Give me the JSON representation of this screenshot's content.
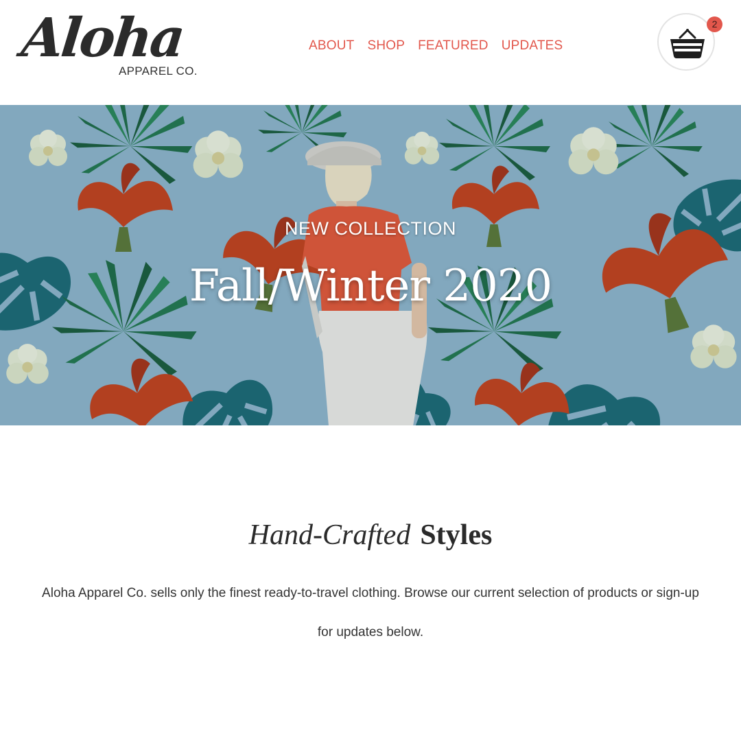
{
  "brand": {
    "logo_script": "Aloha",
    "logo_sub": "APPAREL CO."
  },
  "nav": {
    "items": [
      "ABOUT",
      "SHOP",
      "FEATURED",
      "UPDATES"
    ]
  },
  "cart": {
    "count": "2",
    "icon": "basket-icon"
  },
  "hero": {
    "kicker": "NEW COLLECTION",
    "title": "Fall/Winter 2020"
  },
  "intro": {
    "heading_italic": "Hand-Crafted",
    "heading_bold": "Styles",
    "body": "Aloha Apparel Co. sells only the finest ready-to-travel clothing. Browse our current selection of products or sign-up for updates below."
  },
  "colors": {
    "accent": "#e2574c",
    "hero_bg": "#8fb7cf",
    "text_dark": "#2a2a2a"
  }
}
